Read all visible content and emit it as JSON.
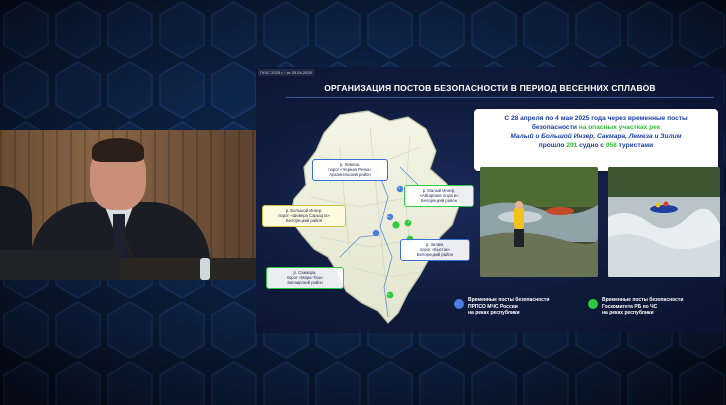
{
  "slide": {
    "stamp": "ГКЧС 2025 г. / от 25.04.2025",
    "title": "ОРГАНИЗАЦИЯ ПОСТОВ БЕЗОПАСНОСТИ В ПЕРИОД ВЕСЕННИХ СПЛАВОВ",
    "info": {
      "p1": "С ",
      "date_range": "28 апреля по 4 мая 2025 года",
      "p2": " через временные посты безопасности ",
      "hl1": "на опасных участках рек",
      "rivers": "Малый и Большой Инзер, Сакмара, Лемеза и Зилим",
      "p3": " прошло ",
      "vessels": "291",
      "p4": " судно с ",
      "tourists": "958",
      "p5": " туристами"
    },
    "callouts": [
      {
        "id": "lemeza",
        "text1": "р. Лемеза,",
        "text2": "порог «Черная Речка»",
        "text3": "Архангельский район"
      },
      {
        "id": "bolshoy-inzer",
        "text1": "р. Большой Инзер,",
        "text2": "порог «Шиверa Сарыщта»",
        "text3": "Белорецкий район"
      },
      {
        "id": "maly-inzer",
        "text1": "р. Малый Инзер,",
        "text2": "«Айгирские пороги»",
        "text3": "Белорецкий район"
      },
      {
        "id": "zilim",
        "text1": "р. Зилим,",
        "text2": "порог «Кыстак»",
        "text3": "Белорецкий район"
      },
      {
        "id": "sakmara",
        "text1": "р. Сакмара,",
        "text2": "порог «Мара-Таш»",
        "text3": "Зилаирский район"
      }
    ],
    "legend": [
      {
        "color": "#4a7fe0",
        "line1": "Временные посты безопасности",
        "line2": "ПРПСО МЧС России",
        "line3": "на реках республики"
      },
      {
        "color": "#2fcb3f",
        "line1": "Временные посты безопасности",
        "line2": "Госкомитета РБ по ЧС",
        "line3": "на реках республики"
      }
    ]
  },
  "colors": {
    "accent_blue": "#1b3fa8",
    "accent_green": "#2fbf35",
    "background": "#08152b"
  }
}
